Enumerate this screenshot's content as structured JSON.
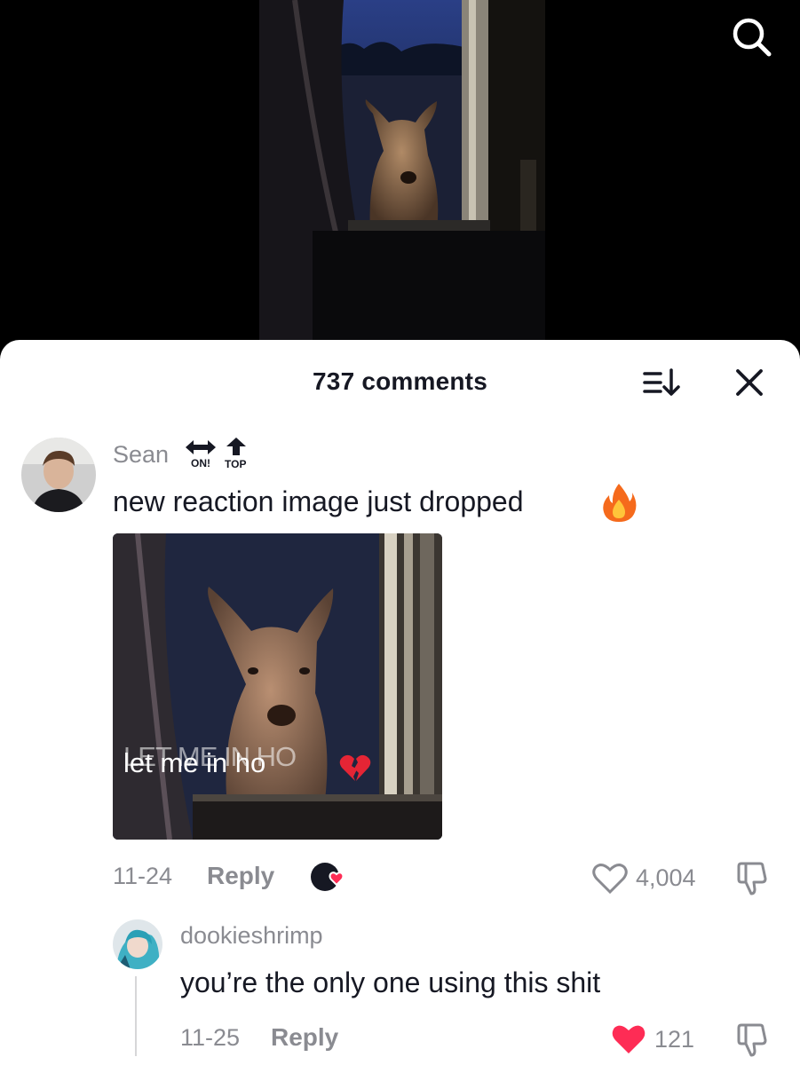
{
  "video": {
    "scene": "deer-at-window"
  },
  "header": {
    "comment_count": "737 comments",
    "icons": {
      "search": "search-icon",
      "sort": "sort-icon",
      "close": "close-icon"
    }
  },
  "comments": [
    {
      "username": "Sean",
      "badges": [
        "ON!",
        "TOP"
      ],
      "text": "new reaction image just dropped",
      "emoji": "fire",
      "image_caption_back": "LET ME IN HO",
      "image_caption_front": "let me in ho",
      "date": "11-24",
      "reply_label": "Reply",
      "like_count": "4,004",
      "liked": false
    },
    {
      "username": "dookieshrimp",
      "text": "you’re the only one using this shit",
      "date": "11-25",
      "reply_label": "Reply",
      "like_count": "121",
      "liked": true
    }
  ],
  "colors": {
    "like_red": "#fe2c55",
    "secondary_text": "#8a8b91",
    "primary_text": "#161823"
  }
}
